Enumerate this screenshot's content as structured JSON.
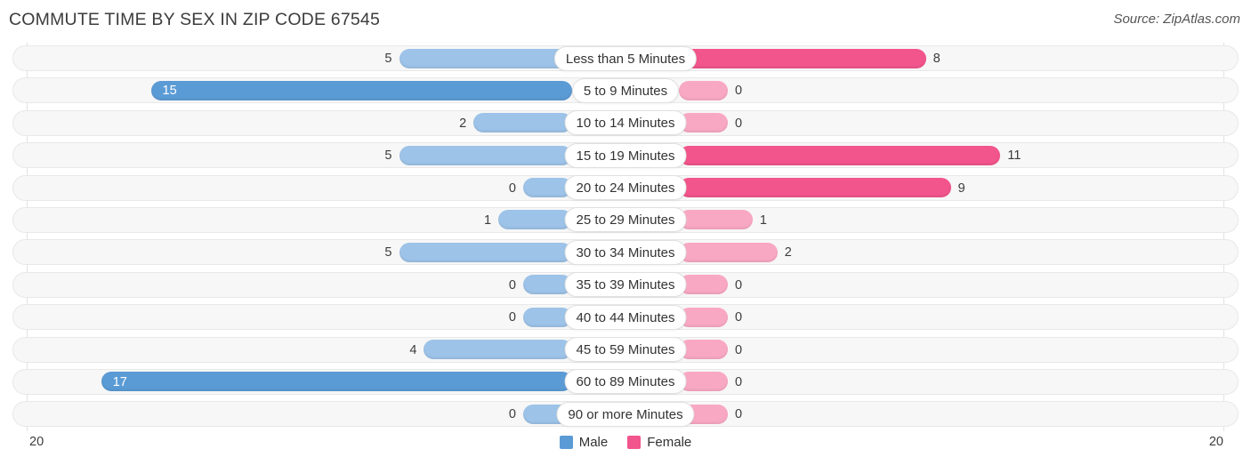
{
  "header": {
    "title": "COMMUTE TIME BY SEX IN ZIP CODE 67545",
    "source": "Source: ZipAtlas.com"
  },
  "legend": {
    "male_label": "Male",
    "female_label": "Female",
    "male_color": "#5b9bd5",
    "female_color": "#f2558c"
  },
  "axis": {
    "left_label": "20",
    "right_label": "20",
    "max": 20
  },
  "colors": {
    "male_light": "#9dc3e8",
    "male_dark": "#5b9bd5",
    "female_light": "#f9a8c4",
    "female_dark": "#f2558c",
    "track_bg": "#f7f7f7",
    "track_border": "#e8e8e8",
    "gridline": "#e2e2e2"
  },
  "chart_data": {
    "type": "bar",
    "title": "COMMUTE TIME BY SEX IN ZIP CODE 67545",
    "subtitle": "",
    "xlabel": "",
    "ylabel": "",
    "orientation": "horizontal-diverging",
    "xlim": [
      20,
      20
    ],
    "grid": true,
    "legend_position": "bottom-center",
    "categories": [
      "Less than 5 Minutes",
      "5 to 9 Minutes",
      "10 to 14 Minutes",
      "15 to 19 Minutes",
      "20 to 24 Minutes",
      "25 to 29 Minutes",
      "30 to 34 Minutes",
      "35 to 39 Minutes",
      "40 to 44 Minutes",
      "45 to 59 Minutes",
      "60 to 89 Minutes",
      "90 or more Minutes"
    ],
    "series": [
      {
        "name": "Male",
        "values": [
          5,
          15,
          2,
          5,
          0,
          1,
          5,
          0,
          0,
          4,
          17,
          0
        ]
      },
      {
        "name": "Female",
        "values": [
          8,
          0,
          0,
          11,
          9,
          1,
          2,
          0,
          0,
          0,
          0,
          0
        ]
      }
    ]
  },
  "rows": [
    {
      "label": "Less than 5 Minutes",
      "male": 5,
      "female": 8,
      "male_inside": false,
      "female_inside": false
    },
    {
      "label": "5 to 9 Minutes",
      "male": 15,
      "female": 0,
      "male_inside": true,
      "female_inside": false
    },
    {
      "label": "10 to 14 Minutes",
      "male": 2,
      "female": 0,
      "male_inside": false,
      "female_inside": false
    },
    {
      "label": "15 to 19 Minutes",
      "male": 5,
      "female": 11,
      "male_inside": false,
      "female_inside": false
    },
    {
      "label": "20 to 24 Minutes",
      "male": 0,
      "female": 9,
      "male_inside": false,
      "female_inside": false
    },
    {
      "label": "25 to 29 Minutes",
      "male": 1,
      "female": 1,
      "male_inside": false,
      "female_inside": false
    },
    {
      "label": "30 to 34 Minutes",
      "male": 5,
      "female": 2,
      "male_inside": false,
      "female_inside": false
    },
    {
      "label": "35 to 39 Minutes",
      "male": 0,
      "female": 0,
      "male_inside": false,
      "female_inside": false
    },
    {
      "label": "40 to 44 Minutes",
      "male": 0,
      "female": 0,
      "male_inside": false,
      "female_inside": false
    },
    {
      "label": "45 to 59 Minutes",
      "male": 4,
      "female": 0,
      "male_inside": false,
      "female_inside": false
    },
    {
      "label": "60 to 89 Minutes",
      "male": 17,
      "female": 0,
      "male_inside": true,
      "female_inside": false
    },
    {
      "label": "90 or more Minutes",
      "male": 0,
      "female": 0,
      "male_inside": false,
      "female_inside": false
    }
  ]
}
